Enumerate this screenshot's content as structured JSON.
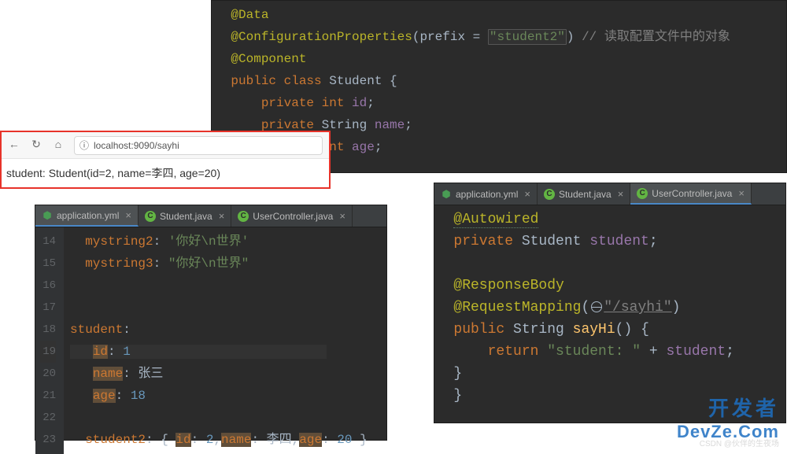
{
  "top_code": {
    "l1": "@Data",
    "l2a": "@ConfigurationProperties",
    "l2b": "(prefix = ",
    "l2c": "\"student2\"",
    "l2d": ") ",
    "l2e": "// 读取配置文件中的对象",
    "l3": "@Component",
    "l4a": "public class ",
    "l4b": "Student ",
    "l4c": "{",
    "l5a": "    private int ",
    "l5b": "id",
    "l5c": ";",
    "l6a": "    private ",
    "l6b": "String ",
    "l6c": "name",
    "l6d": ";",
    "l7a": "    private int ",
    "l7b": "age",
    "l7c": ";"
  },
  "browser": {
    "url": "localhost:9090/sayhi",
    "output": "student: Student(id=2, name=李四, age=20)"
  },
  "yml_tabs": {
    "t1": "application.yml",
    "t2": "Student.java",
    "t3": "UserController.java"
  },
  "yml_lines": [
    "14",
    "15",
    "16",
    "17",
    "18",
    "19",
    "20",
    "21",
    "22",
    "23"
  ],
  "yml_code": {
    "l14a": "mystring2",
    "l14b": ": ",
    "l14c": "'你好\\n世界'",
    "l15a": "mystring3",
    "l15b": ": ",
    "l15c": "\"你好\\n世界\"",
    "l18a": "student",
    "l18b": ":",
    "l19a": "id",
    "l19b": ": ",
    "l19c": "1",
    "l20a": "name",
    "l20b": ": ",
    "l20c": "张三",
    "l21a": "age",
    "l21b": ": ",
    "l21c": "18",
    "l23a": "student2",
    "l23b": ": { ",
    "l23c": "id",
    "l23d": ": ",
    "l23e": "2",
    "l23f": ",",
    "l23g": "name",
    "l23h": ": ",
    "l23i": "李四",
    "l23j": ",",
    "l23k": "age",
    "l23l": ": ",
    "l23m": "20",
    "l23n": " }"
  },
  "ctrl_tabs": {
    "t1": "application.yml",
    "t2": "Student.java",
    "t3": "UserController.java"
  },
  "ctrl_code": {
    "l1": "@Autowired",
    "l2a": "private ",
    "l2b": "Student ",
    "l2c": "student",
    "l2d": ";",
    "l4": "@ResponseBody",
    "l5a": "@RequestMapping",
    "l5b": "(",
    "l5c": "\"/sayhi\"",
    "l5d": ")",
    "l6a": "public ",
    "l6b": "String ",
    "l6c": "sayHi",
    "l6d": "() {",
    "l7a": "    return ",
    "l7b": "\"student: \"",
    "l7c": " + ",
    "l7d": "student",
    "l7e": ";",
    "l8": "}",
    "l9": "}"
  },
  "watermark": {
    "ln1": "开发者",
    "ln2": "DevZe.Com",
    "csdn": "CSDN @伙伴的生夜场"
  }
}
